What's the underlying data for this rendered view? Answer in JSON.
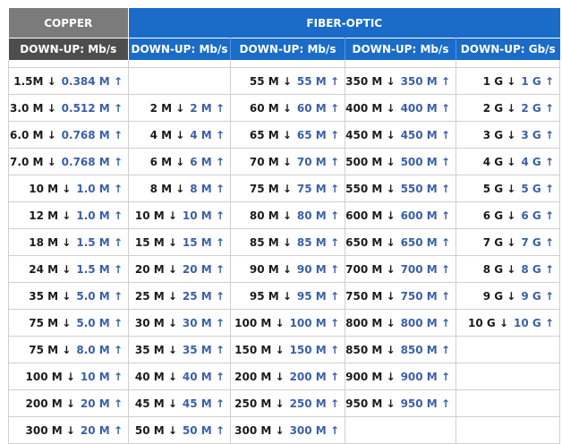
{
  "header": {
    "copper": "COPPER",
    "fiber": "FIBER-OPTIC",
    "columns": [
      "DOWN-UP: Mb/s",
      "DOWN-UP: Mb/s",
      "DOWN-UP: Mb/s",
      "DOWN-UP: Mb/s",
      "DOWN-UP: Gb/s"
    ]
  },
  "arrows": {
    "down": "↓",
    "up": "↑"
  },
  "colors": {
    "copper_group": "#7b7b7b",
    "copper_sub": "#4d4d4d",
    "fiber": "#1a6cc8",
    "up_text": "#3a5faa"
  },
  "columns": [
    [
      {
        "down": "1.5M",
        "up": "0.384 M"
      },
      {
        "down": "3.0 M",
        "up": "0.512 M"
      },
      {
        "down": "6.0 M",
        "up": "0.768 M"
      },
      {
        "down": "7.0 M",
        "up": "0.768 M"
      },
      {
        "down": "10 M",
        "up": "1.0 M"
      },
      {
        "down": "12 M",
        "up": "1.0 M"
      },
      {
        "down": "18 M",
        "up": "1.5 M"
      },
      {
        "down": "24 M",
        "up": "1.5 M"
      },
      {
        "down": "35 M",
        "up": "5.0 M"
      },
      {
        "down": "75 M",
        "up": "5.0 M"
      },
      {
        "down": "75 M",
        "up": "8.0 M"
      },
      {
        "down": "100 M",
        "up": "10 M"
      },
      {
        "down": "200 M",
        "up": "20 M"
      },
      {
        "down": "300 M",
        "up": "20 M"
      }
    ],
    [
      null,
      {
        "down": "2 M",
        "up": "2 M"
      },
      {
        "down": "4 M",
        "up": "4 M"
      },
      {
        "down": "6 M",
        "up": "6 M"
      },
      {
        "down": "8 M",
        "up": "8 M"
      },
      {
        "down": "10 M",
        "up": "10 M"
      },
      {
        "down": "15 M",
        "up": "15 M"
      },
      {
        "down": "20 M",
        "up": "20 M"
      },
      {
        "down": "25 M",
        "up": "25 M"
      },
      {
        "down": "30 M",
        "up": "30 M"
      },
      {
        "down": "35 M",
        "up": "35 M"
      },
      {
        "down": "40 M",
        "up": "40 M"
      },
      {
        "down": "45 M",
        "up": "45 M"
      },
      {
        "down": "50 M",
        "up": "50 M"
      }
    ],
    [
      {
        "down": "55 M",
        "up": "55 M"
      },
      {
        "down": "60 M",
        "up": "60 M"
      },
      {
        "down": "65 M",
        "up": "65 M"
      },
      {
        "down": "70 M",
        "up": "70 M"
      },
      {
        "down": "75 M",
        "up": "75 M"
      },
      {
        "down": "80 M",
        "up": "80 M"
      },
      {
        "down": "85 M",
        "up": "85 M"
      },
      {
        "down": "90 M",
        "up": "90 M"
      },
      {
        "down": "95 M",
        "up": "95 M"
      },
      {
        "down": "100 M",
        "up": "100 M"
      },
      {
        "down": "150 M",
        "up": "150 M"
      },
      {
        "down": "200 M",
        "up": "200 M"
      },
      {
        "down": "250 M",
        "up": "250 M"
      },
      {
        "down": "300 M",
        "up": "300 M"
      }
    ],
    [
      {
        "down": "350 M",
        "up": "350 M"
      },
      {
        "down": "400 M",
        "up": "400 M"
      },
      {
        "down": "450 M",
        "up": "450 M"
      },
      {
        "down": "500 M",
        "up": "500 M"
      },
      {
        "down": "550 M",
        "up": "550 M"
      },
      {
        "down": "600 M",
        "up": "600 M"
      },
      {
        "down": "650 M",
        "up": "650 M"
      },
      {
        "down": "700 M",
        "up": "700 M"
      },
      {
        "down": "750 M",
        "up": "750 M"
      },
      {
        "down": "800 M",
        "up": "800 M"
      },
      {
        "down": "850 M",
        "up": "850 M"
      },
      {
        "down": "900 M",
        "up": "900 M"
      },
      {
        "down": "950 M",
        "up": "950 M"
      },
      null
    ],
    [
      {
        "down": "1 G",
        "up": "1 G"
      },
      {
        "down": "2 G",
        "up": "2 G"
      },
      {
        "down": "3 G",
        "up": "3 G"
      },
      {
        "down": "4 G",
        "up": "4 G"
      },
      {
        "down": "5 G",
        "up": "5 G"
      },
      {
        "down": "6 G",
        "up": "6 G"
      },
      {
        "down": "7 G",
        "up": "7 G"
      },
      {
        "down": "8 G",
        "up": "8 G"
      },
      {
        "down": "9 G",
        "up": "9 G"
      },
      {
        "down": "10 G",
        "up": "10 G"
      },
      null,
      null,
      null,
      null
    ]
  ]
}
